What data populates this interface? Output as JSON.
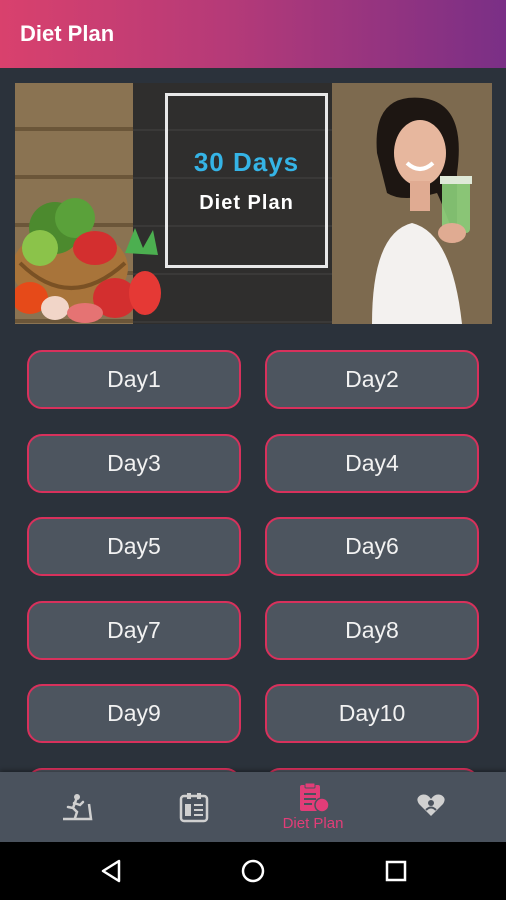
{
  "appbar": {
    "title": "Diet Plan"
  },
  "banner": {
    "days_text": "30 Days",
    "plan_text": "Diet Plan"
  },
  "days": [
    {
      "label": "Day1"
    },
    {
      "label": "Day2"
    },
    {
      "label": "Day3"
    },
    {
      "label": "Day4"
    },
    {
      "label": "Day5"
    },
    {
      "label": "Day6"
    },
    {
      "label": "Day7"
    },
    {
      "label": "Day8"
    },
    {
      "label": "Day9"
    },
    {
      "label": "Day10"
    }
  ],
  "bottom_nav": {
    "items": [
      {
        "icon": "treadmill-icon",
        "label": ""
      },
      {
        "icon": "calendar-icon",
        "label": ""
      },
      {
        "icon": "diet-plan-icon",
        "label": "Diet Plan",
        "active": true
      },
      {
        "icon": "heart-hand-icon",
        "label": ""
      }
    ]
  },
  "colors": {
    "accent": "#d8315c",
    "background": "#2b323b",
    "button": "#4d555f",
    "nav_active": "#e23d78"
  }
}
